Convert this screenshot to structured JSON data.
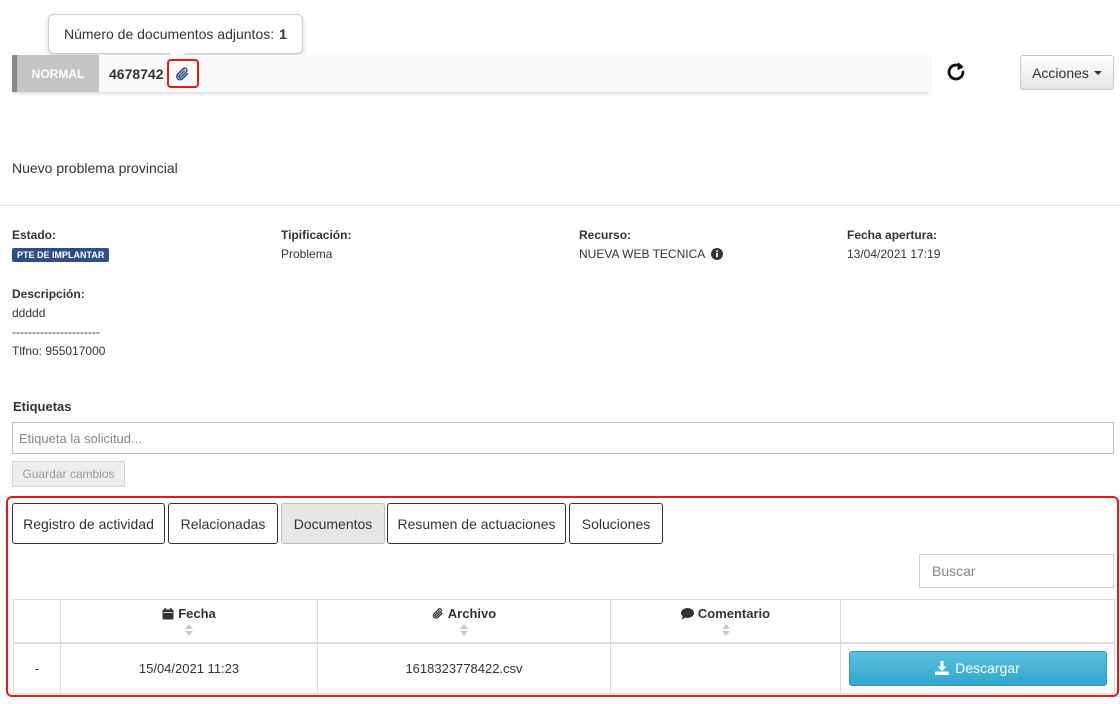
{
  "tooltip": {
    "text": "Número de documentos adjuntos:",
    "count": "1"
  },
  "ticket": {
    "priority": "NORMAL",
    "number": "4678742"
  },
  "header": {
    "actions_label": "Acciones"
  },
  "subject": "Nuevo problema provincial",
  "details": {
    "estado_label": "Estado:",
    "estado_value": "PTE DE IMPLANTAR",
    "tipificacion_label": "Tipificación:",
    "tipificacion_value": "Problema",
    "recurso_label": "Recurso:",
    "recurso_value": "NUEVA WEB TECNICA",
    "fecha_label": "Fecha apertura:",
    "fecha_value": "13/04/2021 17:19",
    "descripcion_label": "Descripción:",
    "descripcion_lines": [
      "ddddd",
      "----------------------",
      "Tlfno: 955017000"
    ]
  },
  "tags": {
    "title": "Etiquetas",
    "placeholder": "Etiqueta la solicitud...",
    "save_label": "Guardar cambios"
  },
  "tabs": [
    {
      "label": "Registro de actividad"
    },
    {
      "label": "Relacionadas"
    },
    {
      "label": "Documentos",
      "active": true
    },
    {
      "label": "Resumen de actuaciones"
    },
    {
      "label": "Soluciones"
    }
  ],
  "documents": {
    "search_placeholder": "Buscar",
    "headers": {
      "fecha": "Fecha",
      "archivo": "Archivo",
      "comentario": "Comentario"
    },
    "rows": [
      {
        "index": "-",
        "fecha": "15/04/2021 11:23",
        "archivo": "1618323778422.csv",
        "comentario": "",
        "action": "Descargar"
      }
    ]
  },
  "colors": {
    "badge": "#2f4e87",
    "highlight": "#e21a1a",
    "download": "#5bc0de"
  },
  "icons": [
    "paperclip-icon",
    "refresh-icon",
    "caret-down-icon",
    "info-icon",
    "calendar-icon",
    "comment-icon",
    "sort-icon",
    "download-icon"
  ]
}
